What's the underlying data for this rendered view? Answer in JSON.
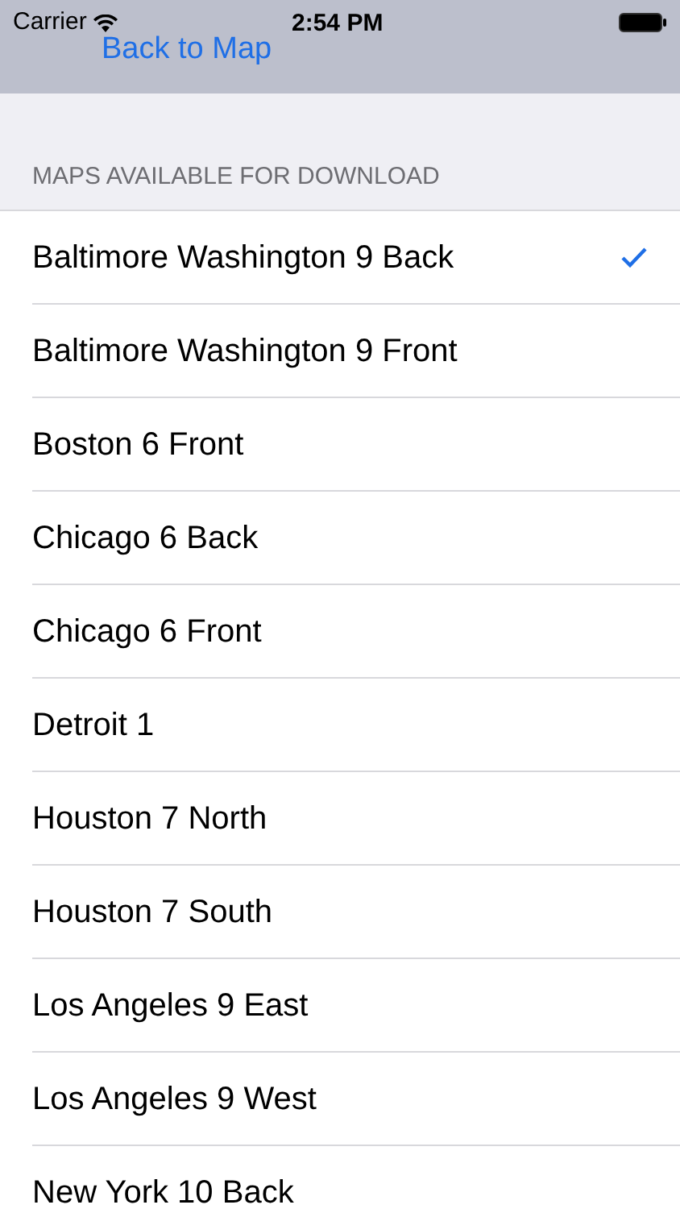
{
  "status_bar": {
    "carrier": "Carrier",
    "time": "2:54 PM"
  },
  "nav": {
    "back": "Back to Map"
  },
  "section": {
    "header": "MAPS AVAILABLE FOR DOWNLOAD"
  },
  "maps": [
    {
      "name": "Baltimore Washington 9 Back",
      "selected": true
    },
    {
      "name": "Baltimore Washington 9 Front",
      "selected": false
    },
    {
      "name": "Boston 6 Front",
      "selected": false
    },
    {
      "name": "Chicago 6 Back",
      "selected": false
    },
    {
      "name": "Chicago 6 Front",
      "selected": false
    },
    {
      "name": "Detroit 1",
      "selected": false
    },
    {
      "name": "Houston 7 North",
      "selected": false
    },
    {
      "name": "Houston 7 South",
      "selected": false
    },
    {
      "name": "Los Angeles 9 East",
      "selected": false
    },
    {
      "name": "Los Angeles 9 West",
      "selected": false
    },
    {
      "name": "New York 10 Back",
      "selected": false
    }
  ]
}
